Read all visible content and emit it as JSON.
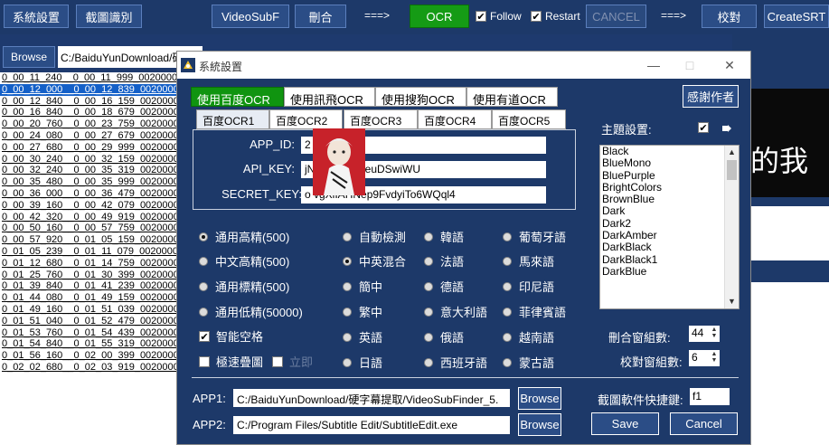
{
  "toolbar": {
    "settings_label": "系統設置",
    "capture_label": "截圖識別",
    "videosubf_label": "VideoSubF",
    "merge_label": "刪合",
    "arrow1": "===>",
    "ocr_label": "OCR",
    "follow_label": "Follow",
    "restart_label": "Restart",
    "cancel_label": "CANCEL",
    "arrow2": "===>",
    "proofread_label": "校對",
    "createsrt_label": "CreateSRT"
  },
  "browse": {
    "button_label": "Browse",
    "path_value": "C:/BaiduYunDownload/硬"
  },
  "file_list": [
    "0_00_11_240__0_00_11_999_00200000010800",
    "0_00_12_000__0_00_12_839_00200000010800",
    "0_00_12_840__0_00_16_159_00200000010800",
    "0_00_16_840__0_00_18_679_00200000010800",
    "0_00_20_760__0_00_23_759_00200000010800",
    "0_00_24_080__0_00_27_679_00200000010800",
    "0_00_27_680__0_00_29_999_00200000010800",
    "0_00_30_240__0_00_32_159_00200000010800",
    "0_00_32_240__0_00_35_319_00200000010800",
    "0_00_35_480__0_00_35_999_00200000010800",
    "0_00_36_000__0_00_36_479_00200000010800",
    "0_00_39_160__0_00_42_079_00200000010800",
    "0_00_42_320__0_00_49_919_00200000010800",
    "0_00_50_160__0_00_57_759_00200000010800",
    "0_00_57_920__0_01_05_159_00200000010800",
    "0_01_05_239__0_01_11_079_00200000010800",
    "0_01_12_680__0_01_14_759_00200000010800",
    "0_01_25_760__0_01_30_399_00200000010800",
    "0_01_39_840__0_01_41_239_00200000010800",
    "0_01_44_080__0_01_49_159_00200000010800",
    "0_01_49_160__0_01_51_039_00200000010800",
    "0_01_51_040__0_01_52_479_00200000010800",
    "0_01_53_760__0_01_54_439_00200000010800",
    "0_01_54_840__0_01_55_319_00200000010800",
    "0_01_56_160__0_02_00_399_00200000010800",
    "0_02_02_680__0_02_03_919_00200000010800"
  ],
  "file_list_selected_index": 1,
  "background_image_text": "的我",
  "dialog": {
    "title": "系統設置",
    "minimize": "—",
    "maximize": "□",
    "close": "✕",
    "engine_tabs": [
      "使用百度OCR",
      "使用訊飛OCR",
      "使用搜狗OCR",
      "使用有道OCR"
    ],
    "active_engine_tab": 0,
    "ocr_tabs": [
      "百度OCR1",
      "百度OCR2",
      "百度OCR3",
      "百度OCR4",
      "百度OCR5"
    ],
    "active_ocr_tab": 0,
    "fields": {
      "app_id_label": "APP_ID:",
      "app_id_value": "2",
      "api_key_label": "API_KEY:",
      "api_key_value": "jN           nYFZOGreuDSwiWU",
      "secret_key_label": "SECRET_KEY:",
      "secret_key_value": "o           vgXlIAHNep9FvdyiTo6WQql4"
    },
    "thanks_button": "感謝作者",
    "theme_label": "主題設置:",
    "themes": [
      "Black",
      "BlueMono",
      "BluePurple",
      "BrightColors",
      "BrownBlue",
      "Dark",
      "Dark2",
      "DarkAmber",
      "DarkBlack",
      "DarkBlack1",
      "DarkBlue"
    ],
    "accuracy_options": [
      "通用高精(500)",
      "中文高精(500)",
      "通用標精(500)",
      "通用低精(50000)"
    ],
    "accuracy_selected": 0,
    "language_options": [
      [
        "自動檢測",
        "韓語",
        "葡萄牙語"
      ],
      [
        "中英混合",
        "法語",
        "馬來語"
      ],
      [
        "簡中",
        "德語",
        "印尼語"
      ],
      [
        "繁中",
        "意大利語",
        "菲律賓語"
      ],
      [
        "英語",
        "俄語",
        "越南語"
      ],
      [
        "日語",
        "西班牙語",
        "蒙古語"
      ]
    ],
    "language_selected": "中英混合",
    "smart_space_label": "智能空格",
    "fast_overlay_label": "極速疊圖",
    "extra_label": "立即",
    "merge_groups_label": "刪合窗組數:",
    "merge_groups_value": "44",
    "proof_groups_label": "校對窗組數:",
    "proof_groups_value": "6",
    "app1_label": "APP1:",
    "app1_path": "C:/BaiduYunDownload/硬字幕提取/VideoSubFinder_5.",
    "app2_label": "APP2:",
    "app2_path": "C:/Program Files/Subtitle Edit/SubtitleEdit.exe",
    "browse_label": "Browse",
    "screenshot_shortcut_label": "截圖軟件快捷鍵:",
    "screenshot_shortcut_value": "f1",
    "save_label": "Save",
    "cancel_label": "Cancel"
  },
  "colors": {
    "app_background": "#1d3969",
    "accent_green": "#109410",
    "selection_blue": "#1460c8"
  }
}
